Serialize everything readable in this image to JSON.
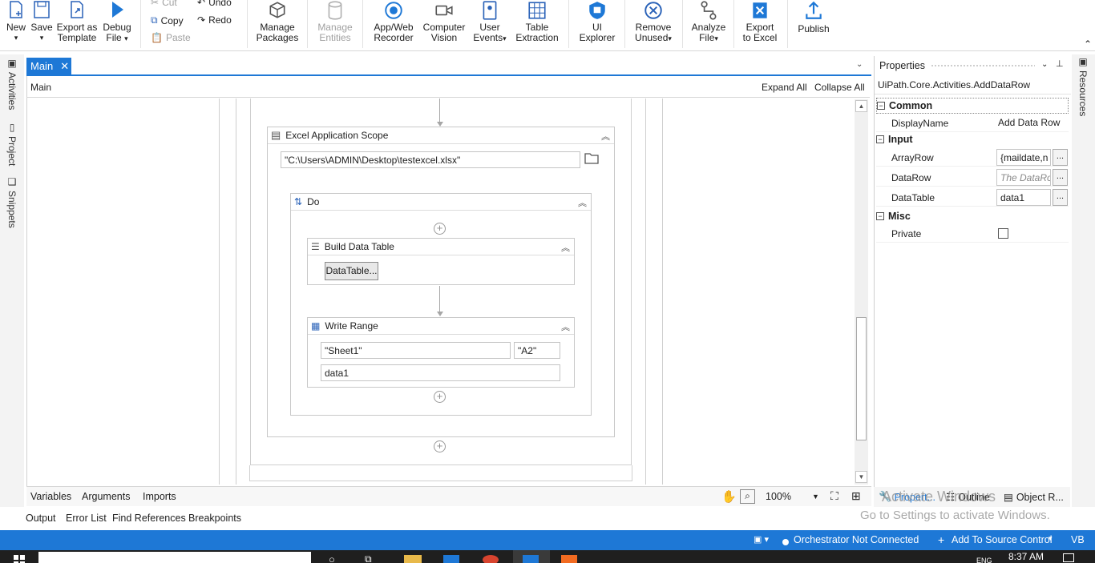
{
  "ribbon": {
    "new": "New",
    "save": "Save",
    "export_template_1": "Export as",
    "export_template_2": "Template",
    "debug_1": "Debug",
    "debug_2": "File",
    "cut": "Cut",
    "copy": "Copy",
    "paste": "Paste",
    "undo": "Undo",
    "redo": "Redo",
    "manage_packages_1": "Manage",
    "manage_packages_2": "Packages",
    "manage_entities_1": "Manage",
    "manage_entities_2": "Entities",
    "recorder_1": "App/Web",
    "recorder_2": "Recorder",
    "cv_1": "Computer",
    "cv_2": "Vision",
    "user_events_1": "User",
    "user_events_2": "Events",
    "table_extraction_1": "Table",
    "table_extraction_2": "Extraction",
    "ui_explorer_1": "UI",
    "ui_explorer_2": "Explorer",
    "remove_unused_1": "Remove",
    "remove_unused_2": "Unused",
    "analyze_1": "Analyze",
    "analyze_2": "File",
    "export_excel_1": "Export",
    "export_excel_2": "to Excel",
    "publish": "Publish"
  },
  "left_rail": {
    "activities": "Activities",
    "project": "Project",
    "snippets": "Snippets"
  },
  "right_rail": {
    "resources": "Resources"
  },
  "document": {
    "tab": "Main",
    "breadcrumb": "Main",
    "expand_all": "Expand All",
    "collapse_all": "Collapse All"
  },
  "workflow": {
    "excel_scope": {
      "title": "Excel Application Scope",
      "path": "\"C:\\Users\\ADMIN\\Desktop\\testexcel.xlsx\""
    },
    "do": {
      "title": "Do"
    },
    "build_data_table": {
      "title": "Build Data Table",
      "button": "DataTable..."
    },
    "write_range": {
      "title": "Write Range",
      "sheet": "\"Sheet1\"",
      "cell": "\"A2\"",
      "datatable": "data1"
    }
  },
  "designer_bottom": {
    "variables": "Variables",
    "arguments": "Arguments",
    "imports": "Imports",
    "zoom": "100%"
  },
  "properties": {
    "title": "Properties",
    "type": "UiPath.Core.Activities.AddDataRow",
    "common": "Common",
    "display_name_label": "DisplayName",
    "display_name_value": "Add Data Row",
    "input": "Input",
    "array_row_label": "ArrayRow",
    "array_row_value": "{maildate,n",
    "data_row_label": "DataRow",
    "data_row_placeholder": "The DataRo",
    "data_table_label": "DataTable",
    "data_table_value": "data1",
    "misc": "Misc",
    "private_label": "Private",
    "private_checked": false,
    "ellipsis": "...",
    "tabs": {
      "properties": "Propert...",
      "outline": "Outline",
      "object_repo": "Object R..."
    }
  },
  "output_bar": {
    "output": "Output",
    "error_list": "Error List",
    "find_references": "Find References",
    "breakpoints": "Breakpoints"
  },
  "watermark": {
    "line1": "Activate Windows",
    "line2": "Go to Settings to activate Windows."
  },
  "status": {
    "orchestrator": "Orchestrator Not Connected",
    "source_control": "Add To Source Control",
    "lang": "VB"
  },
  "taskbar": {
    "time": "8:37 AM",
    "lang": "ENG"
  },
  "colors": {
    "accent": "#1e78d6"
  }
}
